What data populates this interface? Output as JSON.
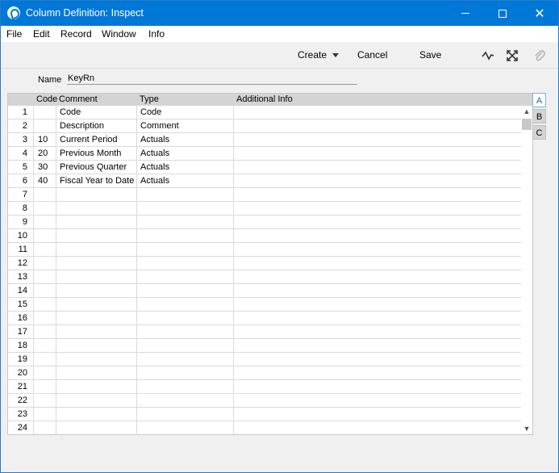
{
  "window": {
    "title": "Column Definition: Inspect",
    "controls": {
      "minimize": "—",
      "maximize": "□",
      "close": "✕"
    }
  },
  "menu": [
    "File",
    "Edit",
    "Record",
    "Window",
    "Info"
  ],
  "toolbar": {
    "create_label": "Create",
    "cancel_label": "Cancel",
    "save_label": "Save",
    "icons": [
      "activity-icon",
      "expand-icon",
      "paperclip-icon"
    ]
  },
  "form": {
    "name_label": "Name",
    "name_value": "KeyRn"
  },
  "grid": {
    "headers": {
      "code": "Code",
      "comment": "Comment",
      "type": "Type",
      "info": "Additional Info"
    },
    "rows": [
      {
        "n": "1",
        "code": "",
        "comment": "Code",
        "type": "Code",
        "info": ""
      },
      {
        "n": "2",
        "code": "",
        "comment": "Description",
        "type": "Comment",
        "info": ""
      },
      {
        "n": "3",
        "code": "10",
        "comment": "Current Period",
        "type": "Actuals",
        "info": ""
      },
      {
        "n": "4",
        "code": "20",
        "comment": "Previous Month",
        "type": "Actuals",
        "info": ""
      },
      {
        "n": "5",
        "code": "30",
        "comment": "Previous Quarter",
        "type": "Actuals",
        "info": ""
      },
      {
        "n": "6",
        "code": "40",
        "comment": "Fiscal Year to Date",
        "type": "Actuals",
        "info": ""
      },
      {
        "n": "7",
        "code": "",
        "comment": "",
        "type": "",
        "info": ""
      },
      {
        "n": "8",
        "code": "",
        "comment": "",
        "type": "",
        "info": ""
      },
      {
        "n": "9",
        "code": "",
        "comment": "",
        "type": "",
        "info": ""
      },
      {
        "n": "10",
        "code": "",
        "comment": "",
        "type": "",
        "info": ""
      },
      {
        "n": "11",
        "code": "",
        "comment": "",
        "type": "",
        "info": ""
      },
      {
        "n": "12",
        "code": "",
        "comment": "",
        "type": "",
        "info": ""
      },
      {
        "n": "13",
        "code": "",
        "comment": "",
        "type": "",
        "info": ""
      },
      {
        "n": "14",
        "code": "",
        "comment": "",
        "type": "",
        "info": ""
      },
      {
        "n": "15",
        "code": "",
        "comment": "",
        "type": "",
        "info": ""
      },
      {
        "n": "16",
        "code": "",
        "comment": "",
        "type": "",
        "info": ""
      },
      {
        "n": "17",
        "code": "",
        "comment": "",
        "type": "",
        "info": ""
      },
      {
        "n": "18",
        "code": "",
        "comment": "",
        "type": "",
        "info": ""
      },
      {
        "n": "19",
        "code": "",
        "comment": "",
        "type": "",
        "info": ""
      },
      {
        "n": "20",
        "code": "",
        "comment": "",
        "type": "",
        "info": ""
      },
      {
        "n": "21",
        "code": "",
        "comment": "",
        "type": "",
        "info": ""
      },
      {
        "n": "22",
        "code": "",
        "comment": "",
        "type": "",
        "info": ""
      },
      {
        "n": "23",
        "code": "",
        "comment": "",
        "type": "",
        "info": ""
      },
      {
        "n": "24",
        "code": "",
        "comment": "",
        "type": "",
        "info": ""
      }
    ]
  },
  "tabs": [
    "A",
    "B",
    "C"
  ],
  "active_tab": "A",
  "colors": {
    "titlebar": "#0078d7",
    "header": "#d4d4d4",
    "active_tab": "#1a66c7"
  }
}
